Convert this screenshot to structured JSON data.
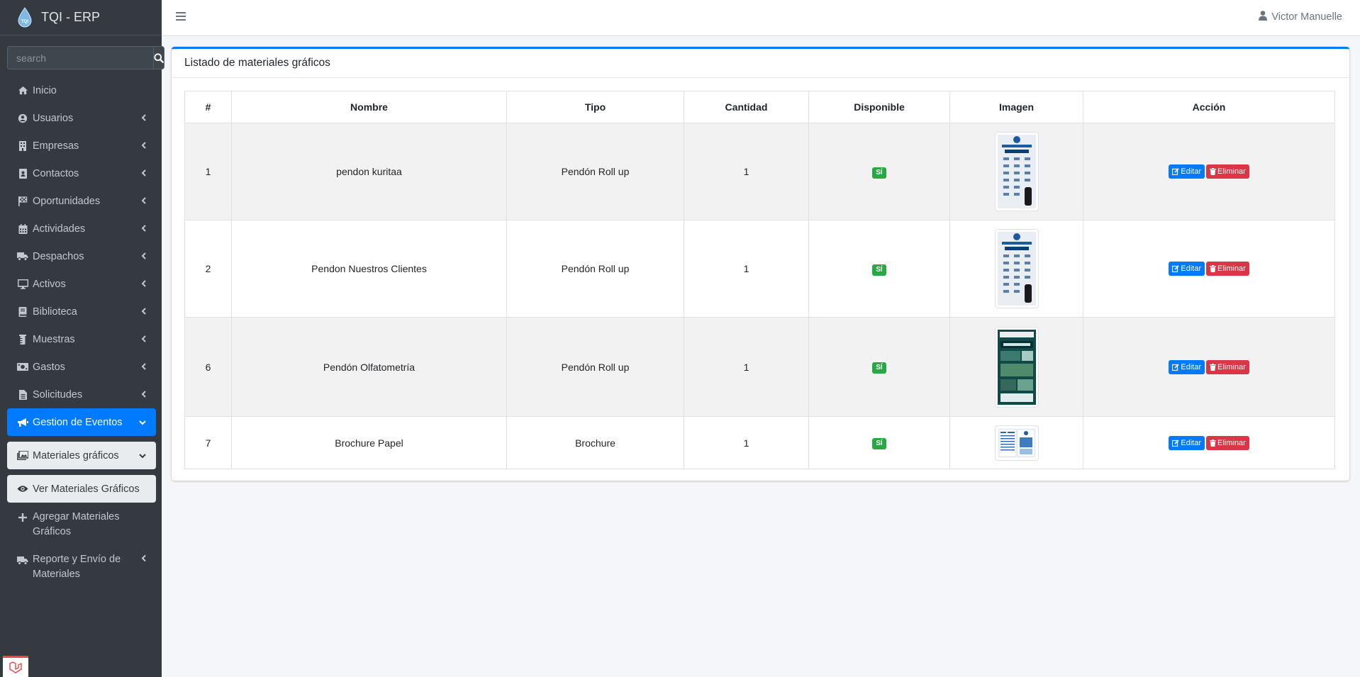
{
  "app": {
    "brand": "TQI - ERP",
    "logo_text": "TQI"
  },
  "search": {
    "placeholder": "search"
  },
  "sidebar": {
    "items": [
      {
        "label": "Inicio",
        "icon": "home-icon"
      },
      {
        "label": "Usuarios",
        "icon": "user-circle-icon"
      },
      {
        "label": "Empresas",
        "icon": "building-icon"
      },
      {
        "label": "Contactos",
        "icon": "address-book-icon"
      },
      {
        "label": "Oportunidades",
        "icon": "flag-checkered-icon"
      },
      {
        "label": "Actividades",
        "icon": "calendar-icon"
      },
      {
        "label": "Despachos",
        "icon": "truck-icon"
      },
      {
        "label": "Activos",
        "icon": "desktop-icon"
      },
      {
        "label": "Biblioteca",
        "icon": "book-icon"
      },
      {
        "label": "Muestras",
        "icon": "vial-icon"
      },
      {
        "label": "Gastos",
        "icon": "money-bill-icon"
      },
      {
        "label": "Solicitudes",
        "icon": "file-icon"
      },
      {
        "label": "Gestion de Eventos",
        "icon": "bullhorn-icon"
      },
      {
        "label": "Materiales gráficos",
        "icon": "images-icon"
      },
      {
        "label": "Ver Materiales Gráficos",
        "icon": "eye-icon"
      },
      {
        "label": "Agregar Materiales Gráficos",
        "icon": "plus-icon"
      },
      {
        "label": "Reporte y Envío de Materiales",
        "icon": "truck-icon"
      }
    ]
  },
  "topbar": {
    "user_name": "Victor Manuelle"
  },
  "card": {
    "title": "Listado de materiales gráficos"
  },
  "table": {
    "columns": [
      "#",
      "Nombre",
      "Tipo",
      "Cantidad",
      "Disponible",
      "Imagen",
      "Acción"
    ],
    "rows": [
      {
        "id": "1",
        "nombre": "pendon kuritaa",
        "tipo": "Pendón Roll up",
        "cantidad": "1",
        "disponible": "SÍ"
      },
      {
        "id": "2",
        "nombre": "Pendon Nuestros Clientes",
        "tipo": "Pendón Roll up",
        "cantidad": "1",
        "disponible": "SÍ"
      },
      {
        "id": "6",
        "nombre": "Pendón Olfatometría",
        "tipo": "Pendón Roll up",
        "cantidad": "1",
        "disponible": "SÍ"
      },
      {
        "id": "7",
        "nombre": "Brochure Papel",
        "tipo": "Brochure",
        "cantidad": "1",
        "disponible": "SÍ"
      }
    ],
    "edit_label": "Editar",
    "delete_label": "Eliminar"
  },
  "colors": {
    "sidebar_bg": "#343a40",
    "primary": "#007bff",
    "success": "#28a745",
    "danger": "#dc3545"
  }
}
